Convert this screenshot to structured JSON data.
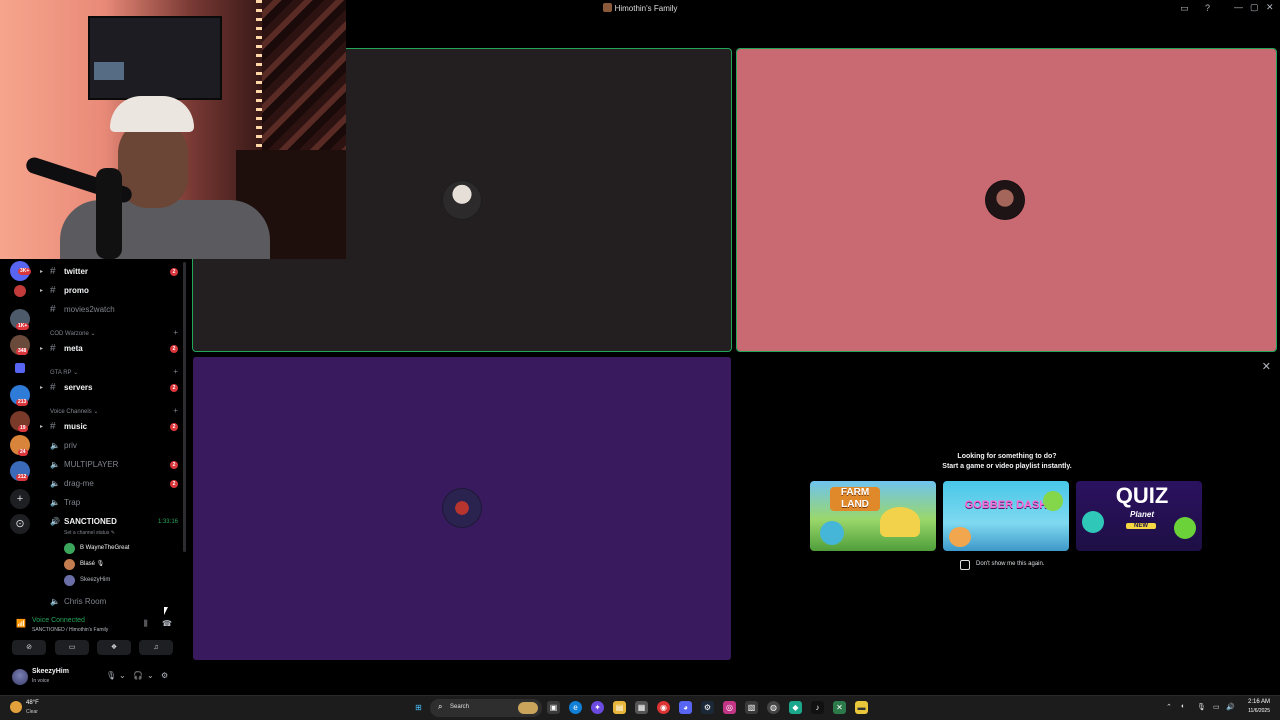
{
  "window": {
    "title": "Himothin's Family"
  },
  "channels": {
    "items": [
      {
        "name": "twitter",
        "mentions": "2"
      },
      {
        "name": "promo"
      },
      {
        "name": "movies2watch"
      },
      {
        "name": "meta",
        "mentions": "2"
      },
      {
        "name": "servers",
        "mentions": "2"
      },
      {
        "name": "music",
        "mentions": "2"
      },
      {
        "name": "priv"
      },
      {
        "name": "MULTIPLAYER",
        "mentions": "2"
      },
      {
        "name": "drag-me",
        "mentions": "2"
      },
      {
        "name": "Trap"
      },
      {
        "name": "SANCTIONED",
        "timer": "1:33:16",
        "status": "Set a channel status"
      },
      {
        "name": "Chris Room"
      }
    ],
    "categories": [
      "COD Warzone",
      "GTA RP",
      "Voice Channels"
    ],
    "voice_users": [
      {
        "name": "B WayneTheGreat",
        "color": "#3ba55c"
      },
      {
        "name": "Blasé 🎙",
        "color": "#c27c4f"
      },
      {
        "name": "SkeezyHim",
        "color": "#6b6fa8"
      }
    ]
  },
  "rail_badges": [
    "3K+",
    "1K+",
    "348",
    "213",
    "19",
    "24",
    "212"
  ],
  "voice": {
    "status": "Voice Connected",
    "location": "SANCTIONED / Himothin's Family"
  },
  "user": {
    "name": "SkeezyHim",
    "status": "In voice"
  },
  "activity": {
    "heading": "Looking for something to do?",
    "subheading": "Start a game or video playlist instantly.",
    "games": [
      {
        "name": "FARM LAND"
      },
      {
        "name": "GOBBER DASH"
      },
      {
        "name": "QUIZ",
        "sub": "Planet",
        "tag": "NEW"
      }
    ],
    "checkbox": "Don't show me this again."
  },
  "taskbar": {
    "temp": "48°F",
    "condition": "Clear",
    "search": "Search",
    "time": "2:16 AM",
    "date": "11/6/2025"
  },
  "colors": {
    "accent_green": "#23a55a",
    "mention_red": "#da373c",
    "tile_dark": "#231f20",
    "tile_pink": "#c96a72",
    "tile_purple": "#3a1a5e"
  }
}
